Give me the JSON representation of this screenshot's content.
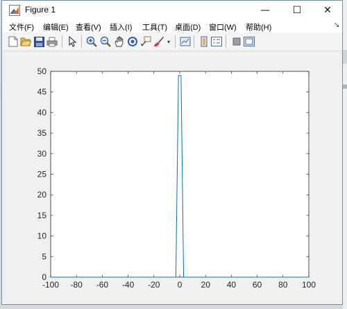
{
  "window": {
    "title": "Figure 1",
    "minimize_glyph": "—",
    "maximize_glyph": "☐",
    "close_glyph": "✕"
  },
  "menubar": {
    "items": [
      {
        "label": "文件(F)"
      },
      {
        "label": "编辑(E)"
      },
      {
        "label": "查看(V)"
      },
      {
        "label": "插入(I)"
      },
      {
        "label": "工具(T)"
      },
      {
        "label": "桌面(D)"
      },
      {
        "label": "窗口(W)"
      },
      {
        "label": "帮助(H)"
      }
    ]
  },
  "toolbar": {
    "icons": [
      "new-figure-icon",
      "open-file-icon",
      "save-icon",
      "print-icon",
      "pointer-icon",
      "zoom-in-icon",
      "zoom-out-icon",
      "pan-icon",
      "rotate-3d-icon",
      "data-cursor-icon",
      "brush-icon",
      "brush-dropdown-icon",
      "link-plot-icon",
      "insert-colorbar-icon",
      "insert-legend-icon",
      "hide-plot-tools-icon",
      "show-plot-tools-icon"
    ]
  },
  "chart_data": {
    "type": "line",
    "title": "",
    "xlabel": "",
    "ylabel": "",
    "xlim": [
      -100,
      100
    ],
    "ylim": [
      0,
      50
    ],
    "xticks": [
      -100,
      -80,
      -60,
      -40,
      -20,
      0,
      20,
      40,
      60,
      80,
      100
    ],
    "yticks": [
      0,
      5,
      10,
      15,
      20,
      25,
      30,
      35,
      40,
      45,
      50
    ],
    "grid": false,
    "line_color": "#0072bd",
    "series": [
      {
        "x": [
          -100,
          -3,
          -1,
          1,
          3,
          100
        ],
        "y": [
          0,
          0,
          49,
          49,
          0,
          0
        ]
      }
    ]
  }
}
